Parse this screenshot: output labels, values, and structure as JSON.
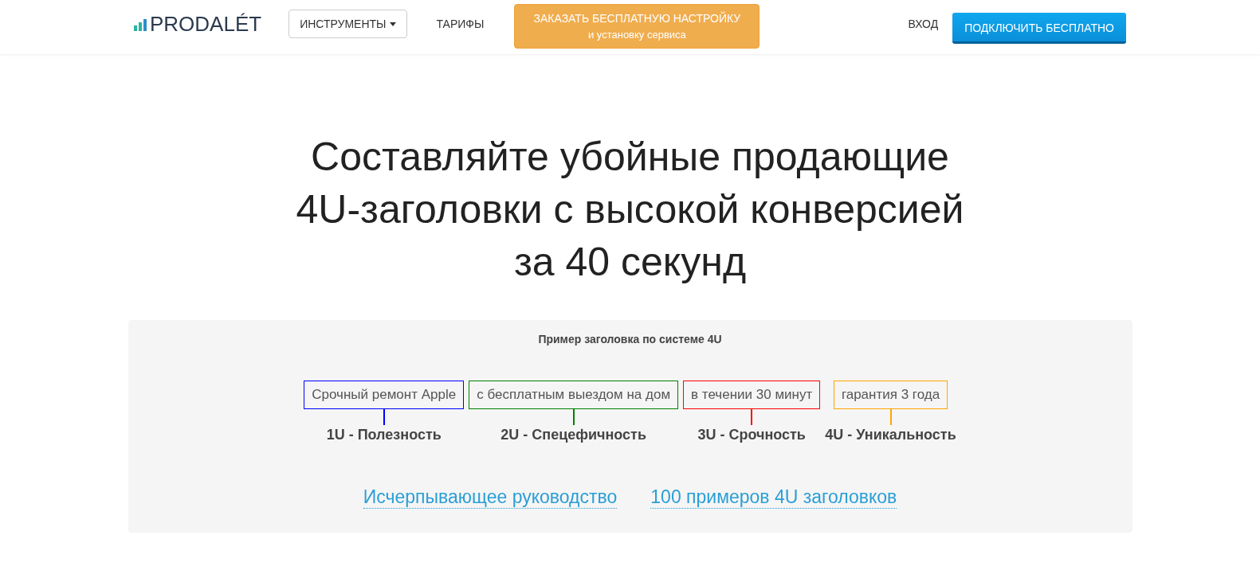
{
  "header": {
    "logo": "PRODALÉT",
    "tools_menu": "ИНСТРУМЕНТЫ",
    "tariffs_link": "ТАРИФЫ",
    "order_button": {
      "line1": "ЗАКАЗАТЬ БЕСПЛАТНУЮ НАСТРОЙКУ",
      "line2": "и установку сервиса"
    },
    "login_link": "ВХОД",
    "connect_button": "ПОДКЛЮЧИТЬ БЕСПЛАТНО"
  },
  "hero": {
    "title_lines": [
      "Составляйте убойные продающие",
      "4U-заголовки с высокой конверсией",
      "за 40 секунд"
    ]
  },
  "example": {
    "caption": "Пример заголовка по системе 4U",
    "parts": [
      {
        "text": "Срочный ремонт Apple",
        "label": "1U - Полезность",
        "color": "#0000ff"
      },
      {
        "text": "с бесплатным выездом на дом",
        "label": "2U - Спецефичность",
        "color": "#008000"
      },
      {
        "text": "в течении 30 минут",
        "label": "3U - Срочность",
        "color": "#ff0000"
      },
      {
        "text": "гарантия 3 года",
        "label": "4U - Уникальность",
        "color": "#ffa500"
      }
    ],
    "links": [
      "Исчерпывающее руководство",
      "100 примеров 4U заголовков"
    ]
  }
}
